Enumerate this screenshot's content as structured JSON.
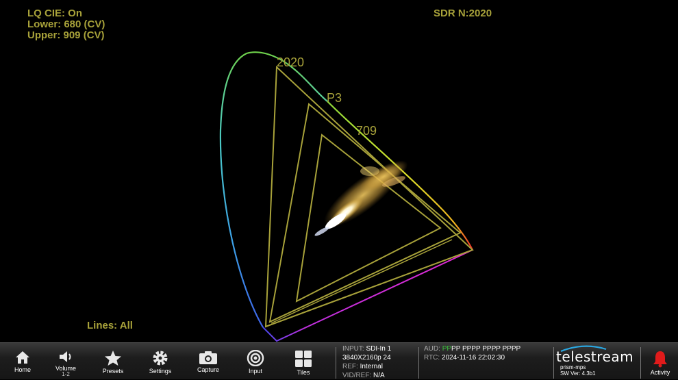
{
  "overlay": {
    "lq_cie": "LQ CIE: On",
    "lower": "Lower: 680 (CV)",
    "upper": "Upper: 909 (CV)",
    "mode": "SDR N:2020",
    "lines": "Lines: All"
  },
  "gamuts": {
    "rec2020": "2020",
    "p3": "P3",
    "rec709": "709"
  },
  "colors": {
    "graticule": "#a8a23a",
    "background": "#000000",
    "toolbar": "#1d1d1d",
    "alarm": "#e01b1b"
  },
  "toolbar": {
    "home": {
      "label": "Home",
      "icon": "home-icon"
    },
    "volume": {
      "label": "Volume",
      "sub": "1-2",
      "icon": "speaker-icon"
    },
    "presets": {
      "label": "Presets",
      "icon": "star-icon"
    },
    "settings": {
      "label": "Settings",
      "icon": "gear-icon"
    },
    "capture": {
      "label": "Capture",
      "icon": "camera-icon"
    },
    "input": {
      "label": "Input",
      "icon": "input-icon"
    },
    "tiles": {
      "label": "Tiles",
      "icon": "tiles-icon"
    },
    "activity": {
      "label": "Activity",
      "icon": "bell-icon"
    }
  },
  "status": {
    "input_key": "INPUT:",
    "input_val": "SDI-In 1",
    "format": "3840X2160p 24",
    "ref_key": "REF:",
    "ref_val": "Internal",
    "vidref_key": "VID/REF:",
    "vidref_val": "N/A",
    "aud_key": "AUD:",
    "aud_green": "PP",
    "aud_rest": "PP PPPP PPPP PPPP",
    "rtc_key": "RTC:",
    "rtc_val": "2024-11-16 22:02:30"
  },
  "brand": {
    "name": "telestream",
    "host": "prism-mps",
    "sw": "SW Ver: 4.3b1"
  }
}
